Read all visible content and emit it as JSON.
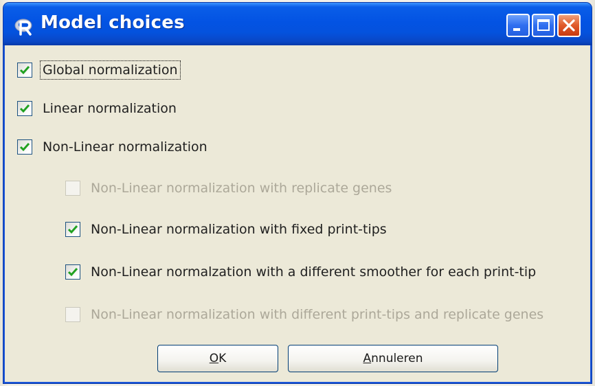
{
  "window": {
    "title": "Model choices",
    "app_icon": "r-logo-icon",
    "controls": [
      "minimize-icon",
      "maximize-icon",
      "close-icon"
    ]
  },
  "options": [
    {
      "label": "Global normalization",
      "checked": true,
      "enabled": true,
      "focused": true
    },
    {
      "label": "Linear normalization",
      "checked": true,
      "enabled": true
    },
    {
      "label": "Non-Linear normalization",
      "checked": true,
      "enabled": true
    },
    {
      "label": "Non-Linear normalization with replicate genes",
      "checked": false,
      "enabled": false
    },
    {
      "label": "Non-Linear normalization with fixed print-tips",
      "checked": true,
      "enabled": true
    },
    {
      "label": "Non-Linear normalzation with a different smoother for each print-tip",
      "checked": true,
      "enabled": true
    },
    {
      "label": "Non-Linear normalization with different print-tips and replicate genes",
      "checked": false,
      "enabled": false
    }
  ],
  "buttons": {
    "ok": {
      "mnemonic": "O",
      "rest": "K"
    },
    "cancel": {
      "mnemonic": "A",
      "rest": "nnuleren"
    }
  },
  "colors": {
    "titlebar": "#0353e3",
    "checkmark": "#21a121",
    "disabled_text": "#aca899"
  }
}
